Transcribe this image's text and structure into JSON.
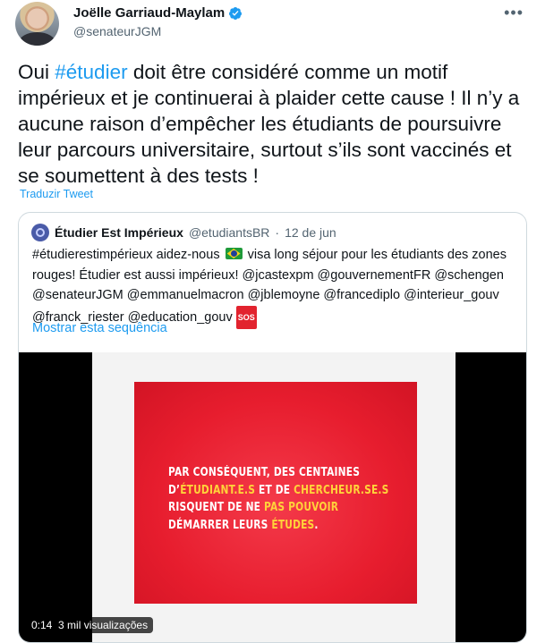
{
  "author": {
    "name": "Joëlle Garriaud-Maylam",
    "handle": "@senateurJGM",
    "verified": true
  },
  "tweet": {
    "text_before": "Oui ",
    "hashtag": "#étudier",
    "text_after": " doit être considéré comme un motif impérieux et je continuerai à plaider cette cause !  Il n’y a aucune raison d’empêcher les étudiants de poursuivre leur parcours universitaire, surtout s’ils sont vaccinés et se soumettent à des tests  !",
    "translate_label": "Traduzir Tweet"
  },
  "more_icon": "more-horizontal-icon",
  "quote": {
    "name": "Étudier Est Impérieux",
    "handle": "@etudiantsBR",
    "separator": "·",
    "date": "12 de jun",
    "text_part1": "#étudierestimpérieux aidez-nous ",
    "flag_icon": "brazil-flag-icon",
    "text_part2": " visa long séjour pour les étudiants des zones rouges! Étudier est aussi impérieux! @jcastexpm @gouvernementFR @schengen @senateurJGM @emmanuelmacron @jblemoyne @francediplo @interieur_gouv @franck_riester @education_gouv ",
    "sos_label": "SOS",
    "show_thread": "Mostrar esta sequência"
  },
  "video": {
    "time": "0:14",
    "views": "3 mil visualizações",
    "poster": {
      "line1": "PAR CONSÉQUENT, DES CENTAINES",
      "line2_a": "D’",
      "line2_b": "ÉTUDIANT.E.S",
      "line2_c": " ET DE ",
      "line2_d": "CHERCHEUR.SE.S",
      "line3_a": "RISQUENT DE NE ",
      "line3_b": "PAS POUVOIR",
      "line4_a": "DÉMARRER LEURS ",
      "line4_b": "ÉTUDES",
      "line4_c": "."
    }
  },
  "colors": {
    "link": "#1d9bf0",
    "poster_red": "#e71d2e",
    "poster_highlight": "#ffd23a"
  }
}
